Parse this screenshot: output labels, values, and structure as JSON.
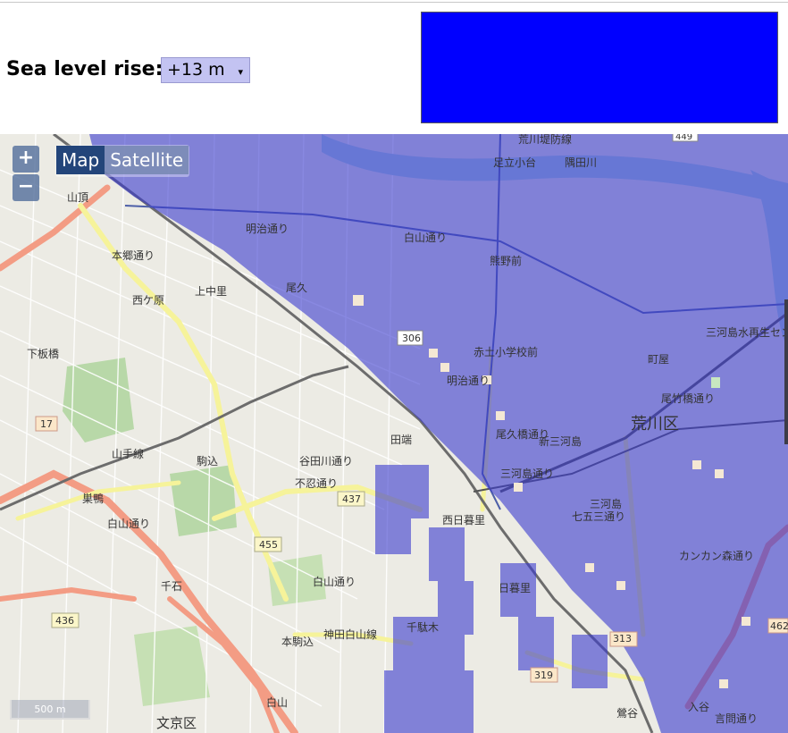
{
  "header": {
    "label": "Sea level rise:",
    "selected_level": "+13 m",
    "dropdown_arrow": "▾",
    "legend_color": "#0000ff"
  },
  "map_controls": {
    "zoom_in": "+",
    "zoom_out": "−",
    "map_type_map": "Map",
    "map_type_satellite": "Satellite",
    "scale_label": "500 m"
  },
  "map_labels": {
    "river_embankment": "荒川堤防線",
    "adachi_odai": "足立小台",
    "sumidagawa": "隅田川",
    "sanchome": "山頂",
    "meiji_dori_n": "明治通り",
    "kumanomae": "熊野前",
    "shirasan_dori_w": "白山通り",
    "hondori": "本郷通り",
    "nishigahara": "西ケ原",
    "kaminakazato": "上中里",
    "oku": "尾久",
    "akado_school": "赤土小学校前",
    "machiya": "町屋",
    "mikawajima_water": "三河島水再生センター",
    "arakawa_ku": "荒川区",
    "odai_dori": "尾竹橋通り",
    "route306": "306",
    "route17": "17",
    "meiji_dori_mid": "明治通り",
    "onden": "尾久橋通り",
    "tabata": "田端",
    "shin_mikawajima": "新三河島",
    "yamanote": "山手線",
    "komagome": "駒込",
    "yanaka_dori": "谷田川通り",
    "shinobazu": "不忍通り",
    "route437": "437",
    "nishi_nippori": "西日暮里",
    "mikawajima": "三河島",
    "shichigo": "七五三通り",
    "sugamo": "巣鴨",
    "hakusan_dori": "白山通り",
    "route455": "455",
    "nippori": "日暮里",
    "kankan": "カンカン森通り",
    "sengoku": "千石",
    "hakusan_dori_n": "白山通り",
    "route436": "436",
    "honkomagome": "本駒込",
    "sendagi": "千駄木",
    "route313": "313",
    "route319": "319",
    "uguisudani": "鶯谷",
    "iriya": "入谷",
    "hakusan": "白山",
    "bunkyo": "文京区",
    "kototoi": "言問通り",
    "shin_mikawa_dori": "三河島通り",
    "kanda_shirayama": "神田白山線",
    "route462": "462",
    "shimo": "下板橋",
    "route449": "449"
  },
  "colors": {
    "flood_overlay": "#3b3bcf",
    "flood_overlay_opacity": "0.6",
    "major_road": "#f39c84",
    "secondary_road": "#f6f39a",
    "park": "#b8d8a8",
    "water": "#aad3df",
    "rail": "#777777"
  }
}
